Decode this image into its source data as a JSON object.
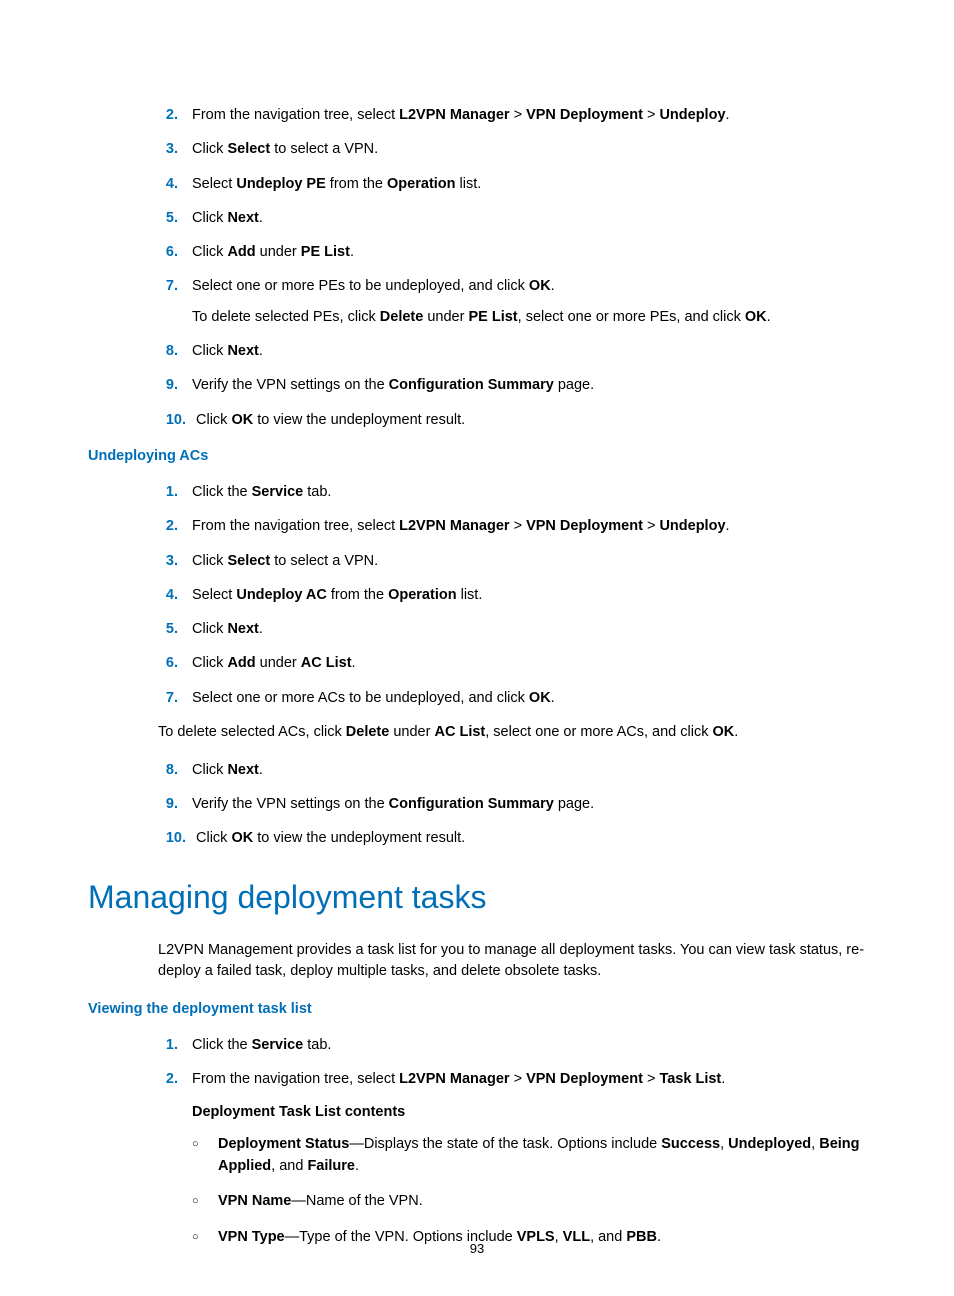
{
  "list1": {
    "items": [
      {
        "n": "2.",
        "parts": [
          "From the navigation tree, select ",
          [
            "b",
            "L2VPN Manager"
          ],
          " > ",
          [
            "b",
            "VPN Deployment"
          ],
          " > ",
          [
            "b",
            "Undeploy"
          ],
          "."
        ]
      },
      {
        "n": "3.",
        "parts": [
          "Click ",
          [
            "b",
            "Select"
          ],
          " to select a VPN."
        ]
      },
      {
        "n": "4.",
        "parts": [
          "Select ",
          [
            "b",
            "Undeploy PE"
          ],
          " from the ",
          [
            "b",
            "Operation"
          ],
          " list."
        ]
      },
      {
        "n": "5.",
        "parts": [
          "Click ",
          [
            "b",
            "Next"
          ],
          "."
        ]
      },
      {
        "n": "6.",
        "parts": [
          "Click ",
          [
            "b",
            "Add"
          ],
          " under ",
          [
            "b",
            "PE List"
          ],
          "."
        ]
      },
      {
        "n": "7.",
        "parts": [
          "Select one or more PEs to be undeployed, and click ",
          [
            "b",
            "OK"
          ],
          "."
        ],
        "sub": [
          "To delete selected PEs, click ",
          [
            "b",
            "Delete"
          ],
          " under ",
          [
            "b",
            "PE List"
          ],
          ", select one or more PEs, and click ",
          [
            "b",
            "OK"
          ],
          "."
        ]
      },
      {
        "n": "8.",
        "parts": [
          "Click ",
          [
            "b",
            "Next"
          ],
          "."
        ]
      },
      {
        "n": "9.",
        "parts": [
          "Verify the VPN settings on the ",
          [
            "b",
            "Configuration Summary"
          ],
          " page."
        ]
      },
      {
        "n": "10.",
        "parts": [
          "Click ",
          [
            "b",
            "OK"
          ],
          " to view the undeployment result."
        ]
      }
    ]
  },
  "heading_ac": "Undeploying ACs",
  "list2": {
    "items": [
      {
        "n": "1.",
        "parts": [
          "Click the ",
          [
            "b",
            "Service"
          ],
          " tab."
        ]
      },
      {
        "n": "2.",
        "parts": [
          "From the navigation tree, select ",
          [
            "b",
            "L2VPN Manager"
          ],
          " > ",
          [
            "b",
            "VPN Deployment"
          ],
          " > ",
          [
            "b",
            "Undeploy"
          ],
          "."
        ]
      },
      {
        "n": "3.",
        "parts": [
          "Click ",
          [
            "b",
            "Select"
          ],
          " to select a VPN."
        ]
      },
      {
        "n": "4.",
        "parts": [
          "Select ",
          [
            "b",
            "Undeploy AC"
          ],
          " from the ",
          [
            "b",
            "Operation"
          ],
          " list."
        ]
      },
      {
        "n": "5.",
        "parts": [
          "Click ",
          [
            "b",
            "Next"
          ],
          "."
        ]
      },
      {
        "n": "6.",
        "parts": [
          "Click ",
          [
            "b",
            "Add"
          ],
          " under ",
          [
            "b",
            "AC List"
          ],
          "."
        ]
      },
      {
        "n": "7.",
        "parts": [
          "Select one or more ACs to be undeployed, and click ",
          [
            "b",
            "OK"
          ],
          "."
        ]
      }
    ]
  },
  "outdent_ac": [
    "To delete selected ACs, click ",
    [
      "b",
      "Delete"
    ],
    " under ",
    [
      "b",
      "AC List"
    ],
    ", select one or more ACs, and click ",
    [
      "b",
      "OK"
    ],
    "."
  ],
  "list2b": {
    "items": [
      {
        "n": "8.",
        "parts": [
          "Click ",
          [
            "b",
            "Next"
          ],
          "."
        ]
      },
      {
        "n": "9.",
        "parts": [
          "Verify the VPN settings on the ",
          [
            "b",
            "Configuration Summary"
          ],
          " page."
        ]
      },
      {
        "n": "10.",
        "parts": [
          "Click ",
          [
            "b",
            "OK"
          ],
          " to view the undeployment result."
        ]
      }
    ]
  },
  "heading_manage": "Managing deployment tasks",
  "para_manage": "L2VPN Management provides a task list for you to manage all deployment tasks. You can view task status, re-deploy a failed task, deploy multiple tasks, and delete obsolete tasks.",
  "heading_view": "Viewing the deployment task list",
  "list3": {
    "items": [
      {
        "n": "1.",
        "parts": [
          "Click the ",
          [
            "b",
            "Service"
          ],
          " tab."
        ]
      },
      {
        "n": "2.",
        "parts": [
          "From the navigation tree, select ",
          [
            "b",
            "L2VPN Manager"
          ],
          " > ",
          [
            "b",
            "VPN Deployment"
          ],
          " > ",
          [
            "b",
            "Task List"
          ],
          "."
        ]
      }
    ]
  },
  "sub_heading": "Deployment Task List contents",
  "bullets": [
    [
      [
        "b",
        "Deployment Status"
      ],
      "—Displays the state of the task. Options include ",
      [
        "b",
        "Success"
      ],
      ", ",
      [
        "b",
        "Undeployed"
      ],
      ", ",
      [
        "b",
        "Being Applied"
      ],
      ", and ",
      [
        "b",
        "Failure"
      ],
      "."
    ],
    [
      [
        "b",
        "VPN Name"
      ],
      "—Name of the VPN."
    ],
    [
      [
        "b",
        "VPN Type"
      ],
      "—Type of the VPN. Options include ",
      [
        "b",
        "VPLS"
      ],
      ", ",
      [
        "b",
        "VLL"
      ],
      ", and ",
      [
        "b",
        "PBB"
      ],
      "."
    ]
  ],
  "bullet_marker": "○",
  "pagenum": "93"
}
